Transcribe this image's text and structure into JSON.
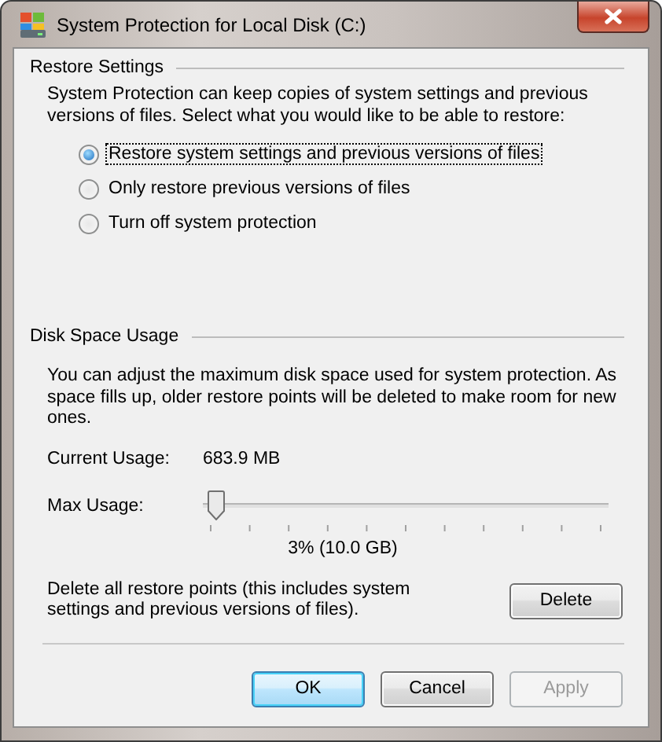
{
  "window": {
    "title": "System Protection for Local Disk (C:)"
  },
  "restore_settings": {
    "heading": "Restore Settings",
    "description": "System Protection can keep copies of system settings and previous versions of files. Select what you would like to be able to restore:",
    "options": [
      {
        "label": "Restore system settings and previous versions of files",
        "selected": true
      },
      {
        "label": "Only restore previous versions of files",
        "selected": false
      },
      {
        "label": "Turn off system protection",
        "selected": false
      }
    ]
  },
  "disk_space_usage": {
    "heading": "Disk Space Usage",
    "description": "You can adjust the maximum disk space used for system protection. As space fills up, older restore points will be deleted to make room for new ones.",
    "current_usage_label": "Current Usage:",
    "current_usage_value": "683.9 MB",
    "max_usage_label": "Max Usage:",
    "max_usage": {
      "level": 0.03
    },
    "max_usage_reading": "3% (10.0 GB)",
    "delete_text": "Delete all restore points (this includes system settings and previous versions of files).",
    "delete_button": "Delete"
  },
  "buttons": [
    {
      "label": "OK",
      "default": true,
      "disabled": false
    },
    {
      "label": "Cancel",
      "default": false,
      "disabled": false
    },
    {
      "label": "Apply",
      "default": false,
      "disabled": true
    }
  ]
}
